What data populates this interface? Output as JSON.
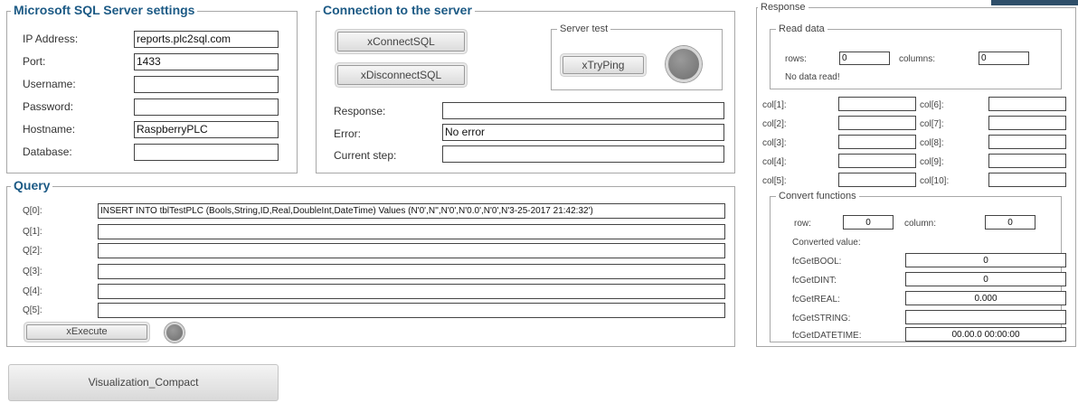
{
  "sql_settings": {
    "title": "Microsoft SQL Server settings",
    "fields": [
      {
        "label": "IP Address:",
        "value": "reports.plc2sql.com"
      },
      {
        "label": "Port:",
        "value": "1433"
      },
      {
        "label": "Username:",
        "value": ""
      },
      {
        "label": "Password:",
        "value": ""
      },
      {
        "label": "Hostname:",
        "value": "RaspberryPLC"
      },
      {
        "label": "Database:",
        "value": ""
      }
    ]
  },
  "connection": {
    "title": "Connection to the server",
    "connect_label": "xConnectSQL",
    "disconnect_label": "xDisconnectSQL",
    "server_test_title": "Server test",
    "ping_label": "xTryPing",
    "response_label": "Response:",
    "response_value": "",
    "error_label": "Error:",
    "error_value": "No error",
    "step_label": "Current step:",
    "step_value": ""
  },
  "query": {
    "title": "Query",
    "rows": [
      {
        "label": "Q[0]:",
        "value": "INSERT INTO tblTestPLC (Bools,String,ID,Real,DoubleInt,DateTime) Values (N'0',N'',N'0',N'0.0',N'0',N'3-25-2017 21:42:32')"
      },
      {
        "label": "Q[1]:",
        "value": ""
      },
      {
        "label": "Q[2]:",
        "value": ""
      },
      {
        "label": "Q[3]:",
        "value": ""
      },
      {
        "label": "Q[4]:",
        "value": ""
      },
      {
        "label": "Q[5]:",
        "value": ""
      }
    ],
    "execute_label": "xExecute"
  },
  "response": {
    "title": "Response",
    "read_data": {
      "title": "Read data",
      "rows_label": "rows:",
      "rows_value": "0",
      "columns_label": "columns:",
      "columns_value": "0",
      "status": "No data read!"
    },
    "cols": [
      {
        "label": "col[1]:",
        "value": ""
      },
      {
        "label": "col[2]:",
        "value": ""
      },
      {
        "label": "col[3]:",
        "value": ""
      },
      {
        "label": "col[4]:",
        "value": ""
      },
      {
        "label": "col[5]:",
        "value": ""
      },
      {
        "label": "col[6]:",
        "value": ""
      },
      {
        "label": "col[7]:",
        "value": ""
      },
      {
        "label": "col[8]:",
        "value": ""
      },
      {
        "label": "col[9]:",
        "value": ""
      },
      {
        "label": "col[10]:",
        "value": ""
      }
    ],
    "convert": {
      "title": "Convert functions",
      "row_label": "row:",
      "row_value": "0",
      "column_label": "column:",
      "column_value": "0",
      "converted_label": "Converted value:",
      "functions": [
        {
          "label": "fcGetBOOL:",
          "value": "0"
        },
        {
          "label": "fcGetDINT:",
          "value": "0"
        },
        {
          "label": "fcGetREAL:",
          "value": "0.000"
        },
        {
          "label": "fcGetSTRING:",
          "value": ""
        },
        {
          "label": "fcGetDATETIME:",
          "value": "00.00.0 00:00:00"
        }
      ]
    }
  },
  "nav": {
    "visualization_label": "Visualization_Compact"
  },
  "colors": {
    "title_blue": "#1c5a85",
    "lamp_gray": "#7d7d7d",
    "header_corner": "#2f4f6a"
  }
}
